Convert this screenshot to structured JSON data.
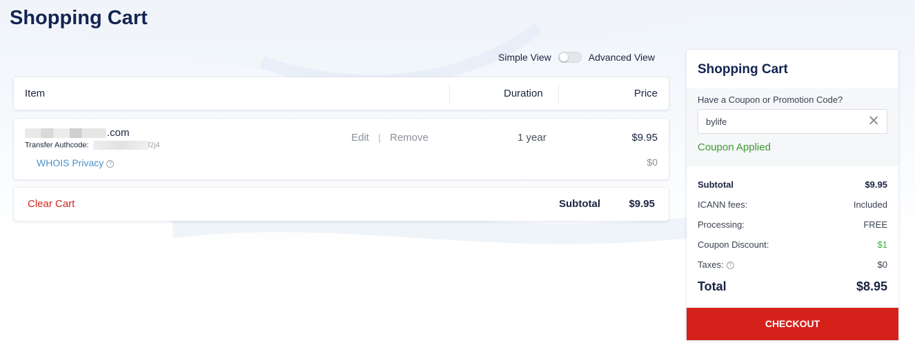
{
  "page": {
    "title": "Shopping Cart"
  },
  "view_toggle": {
    "simple_label": "Simple View",
    "advanced_label": "Advanced View"
  },
  "cart_header": {
    "item": "Item",
    "duration": "Duration",
    "price": "Price"
  },
  "cart_item": {
    "domain_suffix": ".com",
    "authcode_label": "Transfer Authcode:",
    "authcode_visible_tail": "l2j4",
    "edit": "Edit",
    "separator": "|",
    "remove": "Remove",
    "duration": "1 year",
    "price": "$9.95",
    "addon": {
      "label": "WHOIS Privacy",
      "help": "?",
      "price": "$0"
    }
  },
  "cart_footer": {
    "clear_cart": "Clear Cart",
    "subtotal_label": "Subtotal",
    "subtotal_value": "$9.95"
  },
  "sidebar": {
    "title": "Shopping Cart",
    "coupon_label": "Have a Coupon or Promotion Code?",
    "coupon_value": "bylife",
    "coupon_clear": "✕",
    "coupon_status": "Coupon Applied",
    "rows": [
      {
        "label": "Subtotal",
        "value": "$9.95"
      },
      {
        "label": "ICANN fees:",
        "value": "Included"
      },
      {
        "label": "Processing:",
        "value": "FREE"
      },
      {
        "label": "Coupon Discount:",
        "value": "$1"
      },
      {
        "label": "Taxes:",
        "help": "?",
        "value": "$0"
      }
    ],
    "total_label": "Total",
    "total_value": "$8.95",
    "checkout": "CHECKOUT"
  },
  "colors": {
    "title_navy": "#142452",
    "clear_cart_red": "#d0271d",
    "checkout_red": "#d4211a",
    "coupon_green": "#3a9a2e",
    "discount_green": "#3ab043",
    "link_blue": "#4a90c8"
  }
}
